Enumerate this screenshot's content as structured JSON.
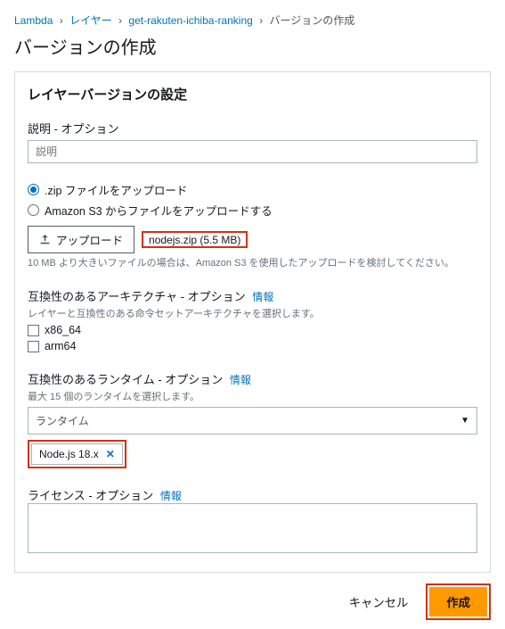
{
  "breadcrumb": {
    "items": [
      "Lambda",
      "レイヤー",
      "get-rakuten-ichiba-ranking"
    ],
    "current": "バージョンの作成"
  },
  "page_title": "バージョンの作成",
  "panel": {
    "title": "レイヤーバージョンの設定",
    "description": {
      "label": "説明 - オプション",
      "placeholder": "説明"
    },
    "upload_source": {
      "opt_zip": ".zip ファイルをアップロード",
      "opt_s3": "Amazon S3 からファイルをアップロードする"
    },
    "upload": {
      "button": "アップロード",
      "file_name": "nodejs.zip (5.5 MB)",
      "hint": "10 MB より大きいファイルの場合は、Amazon S3 を使用したアップロードを検討してください。"
    },
    "arch": {
      "label": "互換性のあるアーキテクチャ - オプション",
      "info": "情報",
      "sub": "レイヤーと互換性のある命令セットアーキテクチャを選択します。",
      "opt_x86": "x86_64",
      "opt_arm": "arm64"
    },
    "runtime": {
      "label": "互換性のあるランタイム - オプション",
      "info": "情報",
      "sub": "最大 15 個のランタイムを選択します。",
      "placeholder": "ランタイム",
      "chip": "Node.js 18.x"
    },
    "license": {
      "label": "ライセンス - オプション",
      "info": "情報"
    }
  },
  "footer": {
    "cancel": "キャンセル",
    "create": "作成"
  }
}
